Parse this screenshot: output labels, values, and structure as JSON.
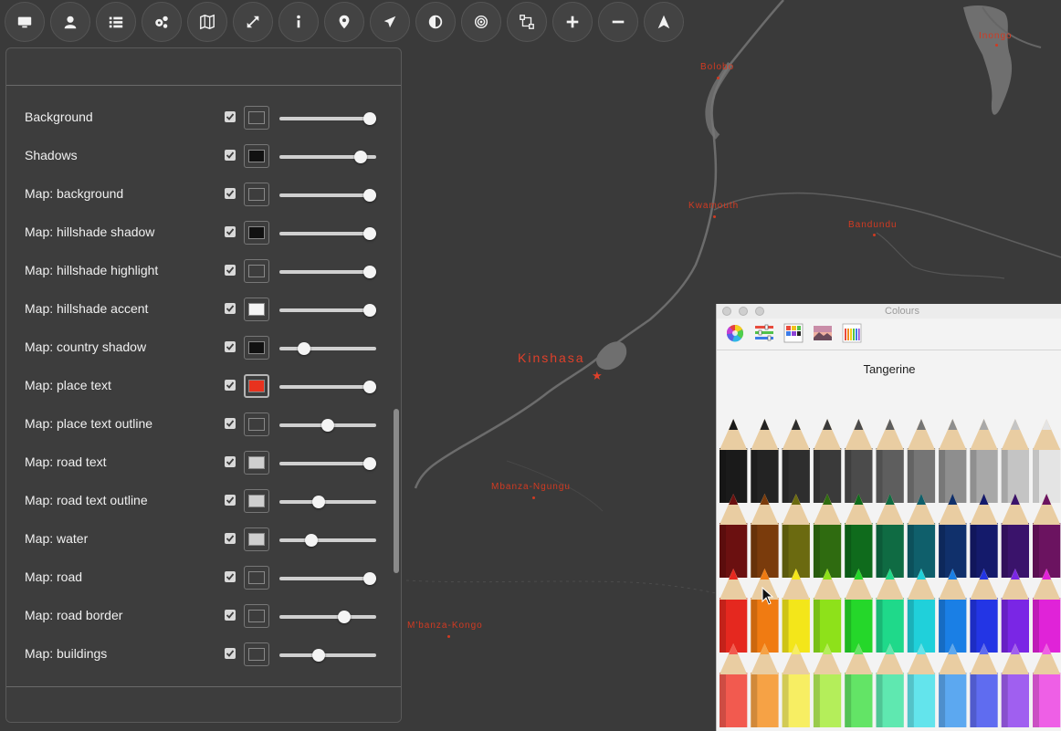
{
  "toolbar": {
    "buttons": [
      {
        "name": "monitor-button",
        "icon": "monitor-icon"
      },
      {
        "name": "user-button",
        "icon": "user-icon"
      },
      {
        "name": "list-button",
        "icon": "list-icon"
      },
      {
        "name": "settings-button",
        "icon": "gears-icon"
      },
      {
        "name": "map-button",
        "icon": "map-icon"
      },
      {
        "name": "fullscreen-button",
        "icon": "expand-icon"
      },
      {
        "name": "info-button",
        "icon": "info-icon"
      },
      {
        "name": "location-button",
        "icon": "map-pin-icon"
      },
      {
        "name": "flights-button",
        "icon": "plane-icon"
      },
      {
        "name": "contrast-button",
        "icon": "contrast-icon"
      },
      {
        "name": "target-button",
        "icon": "target-icon"
      },
      {
        "name": "route-button",
        "icon": "route-icon"
      },
      {
        "name": "zoom-in-button",
        "icon": "plus-icon"
      },
      {
        "name": "zoom-out-button",
        "icon": "minus-icon"
      },
      {
        "name": "north-button",
        "icon": "navigation-arrow-icon"
      }
    ]
  },
  "layers": [
    {
      "label": "Background",
      "checked": true,
      "color": "#3d3d3d",
      "level": 0.93
    },
    {
      "label": "Shadows",
      "checked": true,
      "color": "#111111",
      "level": 0.84
    },
    {
      "label": "Map: background",
      "checked": true,
      "color": "#3d3d3d",
      "level": 0.93
    },
    {
      "label": "Map: hillshade shadow",
      "checked": true,
      "color": "#111111",
      "level": 0.93
    },
    {
      "label": "Map: hillshade highlight",
      "checked": true,
      "color": "#3d3d3d",
      "level": 0.93
    },
    {
      "label": "Map: hillshade accent",
      "checked": true,
      "color": "#f4f4f4",
      "level": 0.93
    },
    {
      "label": "Map: country shadow",
      "checked": true,
      "color": "#111111",
      "level": 0.25
    },
    {
      "label": "Map: place text",
      "checked": true,
      "color": "#e8321e",
      "level": 0.93,
      "selected": true
    },
    {
      "label": "Map: place text outline",
      "checked": true,
      "color": "#3d3d3d",
      "level": 0.5
    },
    {
      "label": "Map: road text",
      "checked": true,
      "color": "#cfcfcf",
      "level": 0.93
    },
    {
      "label": "Map: road text outline",
      "checked": true,
      "color": "#cfcfcf",
      "level": 0.41
    },
    {
      "label": "Map: water",
      "checked": true,
      "color": "#cfcfcf",
      "level": 0.33
    },
    {
      "label": "Map: road",
      "checked": true,
      "color": "#3d3d3d",
      "level": 0.93
    },
    {
      "label": "Map: road border",
      "checked": true,
      "color": "#3d3d3d",
      "level": 0.67
    },
    {
      "label": "Map: buildings",
      "checked": true,
      "color": "#3d3d3d",
      "level": 0.41
    }
  ],
  "map": {
    "places": [
      {
        "name": "Bolobo"
      },
      {
        "name": "Inongo"
      },
      {
        "name": "Kwamouth"
      },
      {
        "name": "Bandundu"
      },
      {
        "name": "Kinshasa",
        "capital": true
      },
      {
        "name": "Mbanza-Ngungu"
      },
      {
        "name": "M'banza-Kongo"
      }
    ],
    "label_color": "#d23a22"
  },
  "colours_window": {
    "title": "Colours",
    "selected_name": "Tangerine",
    "tabs": [
      {
        "name": "color-wheel-tab",
        "icon": "color-wheel-icon"
      },
      {
        "name": "color-sliders-tab",
        "icon": "sliders-icon"
      },
      {
        "name": "color-palettes-tab",
        "icon": "palette-icon"
      },
      {
        "name": "image-palettes-tab",
        "icon": "image-icon"
      },
      {
        "name": "pencils-tab",
        "icon": "pencils-icon"
      }
    ],
    "pencil_rows": [
      [
        "#1a1a1a",
        "#232323",
        "#2e2e2e",
        "#3a3a3a",
        "#4b4b4b",
        "#5e5e5e",
        "#757575",
        "#8e8e8e",
        "#a8a8a8",
        "#c4c4c4",
        "#e4e4e4"
      ],
      [
        "#6b1010",
        "#7a3b0c",
        "#6b6a10",
        "#2f6b10",
        "#0f6b1c",
        "#0f6b43",
        "#0f5f6b",
        "#10306b",
        "#141a6b",
        "#3a136b",
        "#6b1360"
      ],
      [
        "#e5281f",
        "#f07b12",
        "#f3e61a",
        "#8ee11a",
        "#25d72a",
        "#1fd98a",
        "#20d0da",
        "#1a7fe5",
        "#2335e5",
        "#7a26e5",
        "#e023d8"
      ],
      [
        "#f25a4f",
        "#f6a245",
        "#f7ee63",
        "#b4ee5a",
        "#63e466",
        "#5fe8b0",
        "#63e4ec",
        "#5ca8f0",
        "#5f6cf0",
        "#a05ff0",
        "#ee5fe6"
      ]
    ]
  }
}
